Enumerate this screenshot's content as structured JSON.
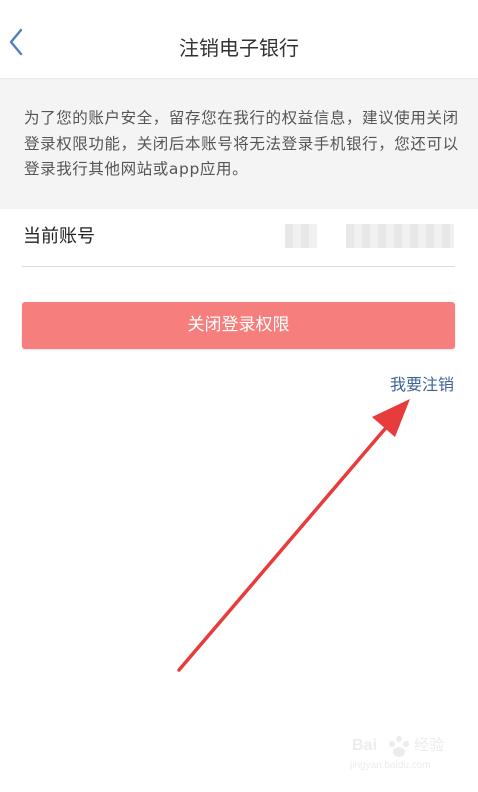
{
  "nav": {
    "title": "注销电子银行"
  },
  "notice": {
    "text": "为了您的账户安全，留存您在我行的权益信息，建议使用关闭登录权限功能，关闭后本账号将无法登录手机银行，您还可以登录我行其他网站或app应用。"
  },
  "account": {
    "label": "当前账号",
    "value_masked": true
  },
  "actions": {
    "close_login_label": "关闭登录权限",
    "cancel_link_label": "我要注销"
  },
  "watermark": {
    "text": "Bai 经验",
    "subtext": "jingyan.baidu.com"
  },
  "colors": {
    "primary_button": "#f67f7e",
    "link": "#3f6595",
    "annotation_arrow": "#e83b3b",
    "notice_background": "#f4f4f4",
    "title_text": "#333333"
  },
  "icons": {
    "back": "chevron-left-icon",
    "annotation": "red-arrow-icon",
    "watermark": "baidu-paw-icon"
  }
}
